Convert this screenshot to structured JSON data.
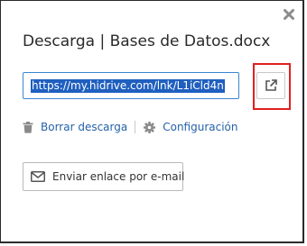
{
  "dialog": {
    "title": "Descarga | Bases de Datos.docx",
    "close_icon": "close-icon",
    "link_field": {
      "value": "https://my.hidrive.com/lnk/L1iCld4n"
    },
    "open_link_icon": "external-link-icon",
    "actions": [
      {
        "icon": "trash-icon",
        "label": "Borrar descarga"
      },
      {
        "icon": "gear-icon",
        "label": "Configuración"
      }
    ],
    "email_button": {
      "icon": "envelope-icon",
      "label": "Enviar enlace por e-mail"
    }
  },
  "colors": {
    "link": "#2462a8",
    "selection": "#1f5fbf",
    "field_border": "#3a86d4",
    "annotation_box": "#e02020",
    "title_text": "#2a2a2a"
  }
}
